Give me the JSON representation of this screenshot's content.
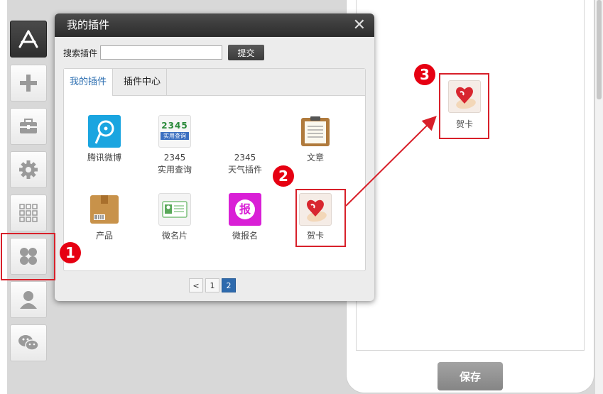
{
  "dialog": {
    "title": "我的插件",
    "close_label": "✕",
    "search_label": "搜索插件",
    "search_value": "",
    "submit_label": "提交",
    "tabs": [
      {
        "label": "我的插件",
        "active": true
      },
      {
        "label": "插件中心",
        "active": false
      }
    ],
    "plugins": [
      {
        "name": "腾讯微博",
        "icon": "tencent-weibo-icon"
      },
      {
        "name": "2345\n实用查询",
        "icon": "2345-query-icon",
        "logo_text": "2345",
        "logo_sub": "实用查询"
      },
      {
        "name": "2345\n天气插件",
        "icon": "weather-icon"
      },
      {
        "name": "文章",
        "icon": "clipboard-icon"
      },
      {
        "name": "产品",
        "icon": "box-icon"
      },
      {
        "name": "微名片",
        "icon": "business-card-icon"
      },
      {
        "name": "微报名",
        "icon": "signup-icon",
        "logo_text": "报"
      },
      {
        "name": "贺卡",
        "icon": "greeting-card-icon"
      }
    ],
    "pagination": {
      "prev": "<",
      "pages": [
        "1",
        "2"
      ],
      "current": "2"
    }
  },
  "preview": {
    "card_name": "贺卡",
    "save_label": "保存"
  },
  "steps": [
    "1",
    "2",
    "3"
  ],
  "colors": {
    "accent": "#2e6aad",
    "highlight": "#d8202a",
    "step_badge": "#e60012"
  }
}
